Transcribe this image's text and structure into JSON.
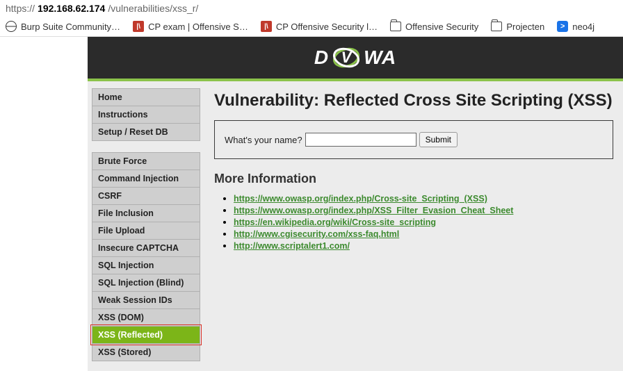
{
  "url": {
    "prefix": "https://",
    "host": "192.168.62.174",
    "path": "/vulnerabilities/xss_r/"
  },
  "bookmarks": {
    "burp": "Burp Suite Community…",
    "cp_exam": "CP exam | Offensive S…",
    "cp_off": "CP Offensive Security l…",
    "offsec": "Offensive Security",
    "projecten": "Projecten",
    "neo4j": "neo4j"
  },
  "logo": {
    "left": "D",
    "right": "WA"
  },
  "sidebar": {
    "group1": [
      {
        "key": "home",
        "label": "Home"
      },
      {
        "key": "instructions",
        "label": "Instructions"
      },
      {
        "key": "setup",
        "label": "Setup / Reset DB"
      }
    ],
    "group2": [
      {
        "key": "brute",
        "label": "Brute Force"
      },
      {
        "key": "cmd",
        "label": "Command Injection"
      },
      {
        "key": "csrf",
        "label": "CSRF"
      },
      {
        "key": "file-inc",
        "label": "File Inclusion"
      },
      {
        "key": "file-up",
        "label": "File Upload"
      },
      {
        "key": "captcha",
        "label": "Insecure CAPTCHA"
      },
      {
        "key": "sqli",
        "label": "SQL Injection"
      },
      {
        "key": "sqli-blind",
        "label": "SQL Injection (Blind)"
      },
      {
        "key": "weak-sess",
        "label": "Weak Session IDs"
      },
      {
        "key": "xss-dom",
        "label": "XSS (DOM)"
      },
      {
        "key": "xss-refl",
        "label": "XSS (Reflected)"
      },
      {
        "key": "xss-stored",
        "label": "XSS (Stored)"
      }
    ]
  },
  "main": {
    "title": "Vulnerability: Reflected Cross Site Scripting (XSS)",
    "form_label": "What's your name?",
    "submit_label": "Submit",
    "more_info": "More Information",
    "links": [
      "https://www.owasp.org/index.php/Cross-site_Scripting_(XSS)",
      "https://www.owasp.org/index.php/XSS_Filter_Evasion_Cheat_Sheet",
      "https://en.wikipedia.org/wiki/Cross-site_scripting",
      "http://www.cgisecurity.com/xss-faq.html",
      "http://www.scriptalert1.com/"
    ]
  }
}
